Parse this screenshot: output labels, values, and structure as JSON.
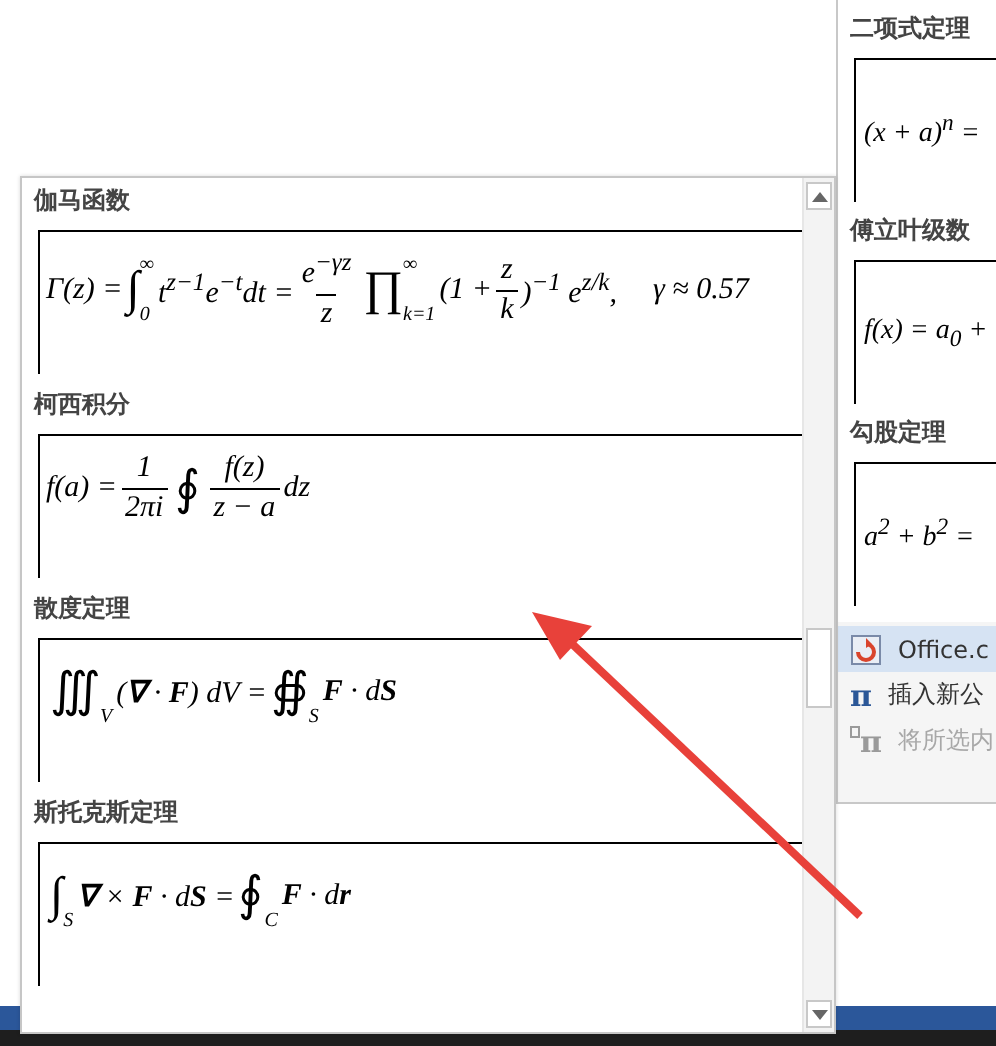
{
  "back_gallery": {
    "items": [
      {
        "title": "二项式定理",
        "formula": "(x + a)$^{n}$ ="
      },
      {
        "title": "傅立叶级数",
        "formula": "f(x) = a$_{0}$ +"
      },
      {
        "title": "勾股定理",
        "formula": "a$^{2}$ + b$^{2}$ ="
      }
    ],
    "menu": [
      {
        "kind": "office",
        "label": "Office.c",
        "highlighted": true,
        "disabled": false
      },
      {
        "kind": "pi",
        "icon": "π",
        "label": "插入新公",
        "highlighted": false,
        "disabled": false
      },
      {
        "kind": "pi-save",
        "icon": "π",
        "label": "将所选内",
        "highlighted": false,
        "disabled": true
      }
    ]
  },
  "gallery": {
    "items": [
      {
        "title": "伽马函数",
        "tokens": [
          {
            "kind": "text",
            "text": "Γ(z) = "
          },
          {
            "kind": "operator",
            "symbol": "∫",
            "lower": "0",
            "upper": "∞"
          },
          {
            "kind": "text",
            "text": "t$^{z−1}$e$^{−t}$dt = "
          },
          {
            "kind": "fraction",
            "numerator": "e$^{−γz}$",
            "denominator": "z"
          },
          {
            "kind": "operator",
            "symbol": "∏",
            "lower": "k=1",
            "upper": "∞"
          },
          {
            "kind": "text",
            "text": "(1 + "
          },
          {
            "kind": "fraction",
            "numerator": "z",
            "denominator": "k"
          },
          {
            "kind": "text",
            "text": ")$^{−1}$ e$^{z/k}$,"
          },
          {
            "kind": "text",
            "text": "γ ≈ 0.57"
          }
        ]
      },
      {
        "title": "柯西积分",
        "tokens": [
          {
            "kind": "text",
            "text": "f(a) = "
          },
          {
            "kind": "fraction",
            "numerator": "1",
            "denominator": "2πi"
          },
          {
            "kind": "operator",
            "symbol": "∮"
          },
          {
            "kind": "fraction",
            "numerator": "f(z)",
            "denominator": "z − a"
          },
          {
            "kind": "text",
            "text": "dz"
          }
        ]
      },
      {
        "title": "散度定理",
        "tokens": [
          {
            "kind": "operator",
            "symbol": "∭",
            "lower": "V"
          },
          {
            "kind": "text",
            "text": "(**∇** · **F**) dV = "
          },
          {
            "kind": "operator",
            "symbol": "∯",
            "lower": "S"
          },
          {
            "kind": "text",
            "text": "**F** · d**S**"
          }
        ]
      },
      {
        "title": "斯托克斯定理",
        "tokens": [
          {
            "kind": "operator",
            "symbol": "∫",
            "lower": "S"
          },
          {
            "kind": "text",
            "text": "**∇** × **F** · d**S** = "
          },
          {
            "kind": "operator",
            "symbol": "∮",
            "lower": "C"
          },
          {
            "kind": "text",
            "text": "**F** · d**r**"
          }
        ]
      }
    ]
  }
}
